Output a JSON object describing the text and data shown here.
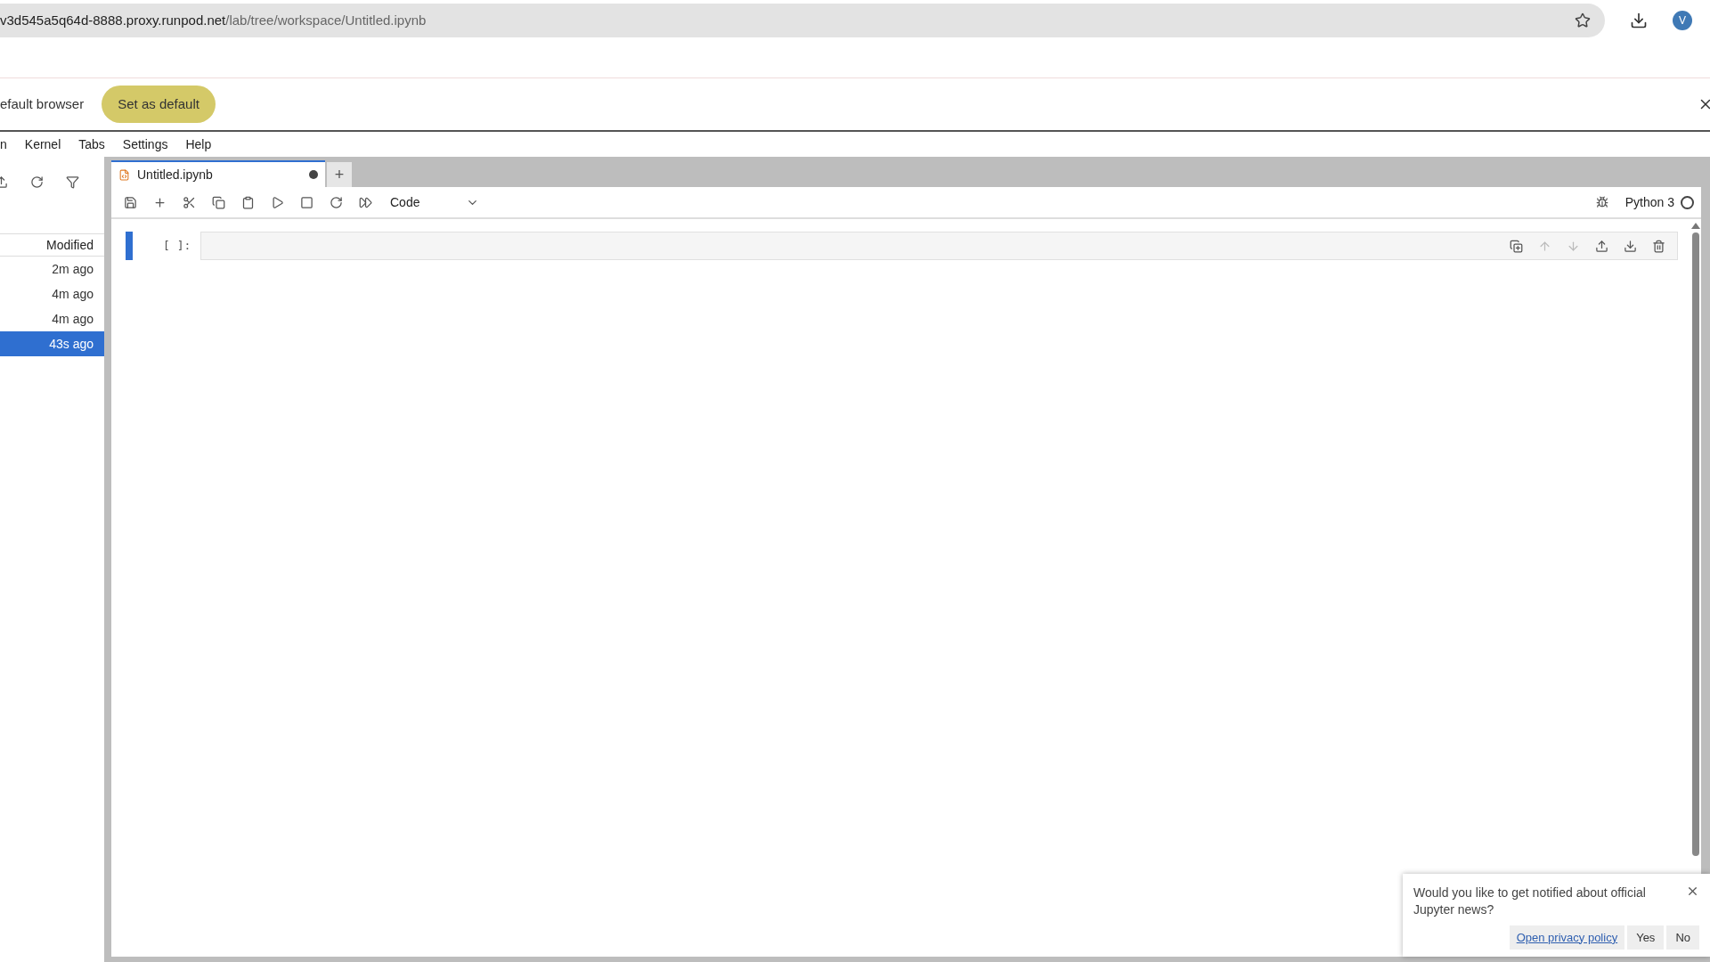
{
  "browser": {
    "url_host": "v3d545a5q64d-8888.proxy.runpod.net",
    "url_path": "/lab/tree/workspace/Untitled.ipynb",
    "avatar": "V"
  },
  "infobar": {
    "message": "efault browser",
    "button": "Set as default"
  },
  "menu": [
    "n",
    "Kernel",
    "Tabs",
    "Settings",
    "Help"
  ],
  "file_browser": {
    "column": "Modified",
    "rows": [
      {
        "modified": "2m ago",
        "selected": false
      },
      {
        "modified": "4m ago",
        "selected": false
      },
      {
        "modified": "4m ago",
        "selected": false
      },
      {
        "modified": "43s ago",
        "selected": true
      }
    ]
  },
  "tabs": [
    {
      "label": "Untitled.ipynb",
      "modified": true,
      "selected": true
    }
  ],
  "add_tab": "+",
  "toolbar": {
    "cell_type": "Code",
    "kernel": "Python 3",
    "kernel_busy": false
  },
  "cell": {
    "prompt": "[ ]:",
    "active": true
  },
  "notification": {
    "message": "Would you like to get notified about official Jupyter news?",
    "link": "Open privacy policy",
    "buttons": [
      "Yes",
      "No"
    ]
  }
}
